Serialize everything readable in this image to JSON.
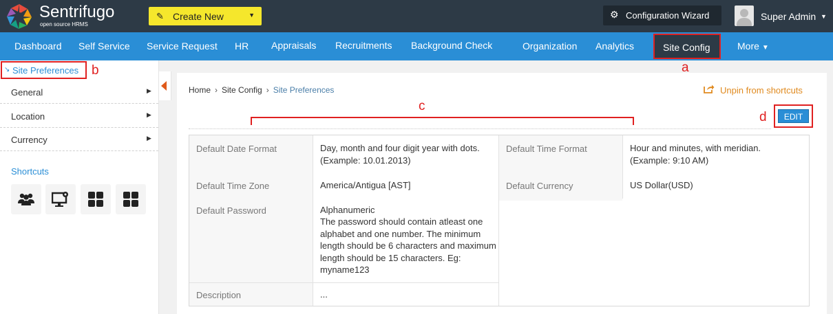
{
  "header": {
    "brand": "Sentrifugo",
    "brand_sub": "open source HRMS",
    "create_new": "Create New",
    "config_wizard": "Configuration Wizard",
    "user": "Super Admin"
  },
  "nav": {
    "items": [
      "Dashboard",
      "Self Service",
      "Service Request",
      "HR",
      "Appraisals",
      "Recruitments",
      "Background Check",
      "Organization",
      "Analytics"
    ],
    "active": "Site Config",
    "more": "More"
  },
  "sidebar": {
    "title": "Site Preferences",
    "items": [
      "General",
      "Location",
      "Currency"
    ],
    "shortcuts_title": "Shortcuts",
    "shortcut_icons": [
      "users-icon",
      "monitor-settings-icon",
      "grid-icon",
      "grid-icon"
    ]
  },
  "breadcrumb": [
    "Home",
    "Site Config",
    "Site Preferences"
  ],
  "unpin": "Unpin from shortcuts",
  "edit": "EDIT",
  "annotations": {
    "a": "a",
    "b": "b",
    "c": "c",
    "d": "d"
  },
  "details": {
    "date_format_label": "Default Date Format",
    "date_format_value": "Day, month and four digit year with dots. (Example: 10.01.2013)",
    "time_format_label": "Default Time Format",
    "time_format_value": "Hour and minutes, with meridian. (Example: 9:10 AM)",
    "timezone_label": "Default Time Zone",
    "timezone_value": "America/Antigua [AST]",
    "currency_label": "Default Currency",
    "currency_value": "US Dollar(USD)",
    "password_label": "Default Password",
    "password_value": "Alphanumeric",
    "password_desc": "The password should contain atleast one alphabet and one number. The minimum length should be 6 characters and maximum length should be 15 characters. Eg: myname123",
    "description_label": "Description",
    "description_value": "..."
  },
  "colors": {
    "topbar": "#2d3a46",
    "navbar": "#2a8ed6",
    "create_button": "#f5e72c",
    "annotation_red": "#e02020",
    "unpin_orange": "#e08a1f"
  }
}
